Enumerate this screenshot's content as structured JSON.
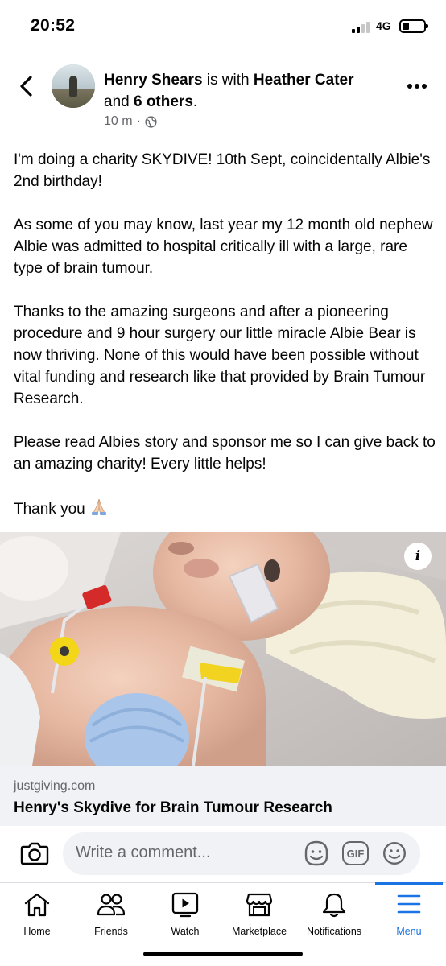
{
  "status_bar": {
    "time": "20:52",
    "network": "4G",
    "battery_level": 0.25,
    "signal_bars": 2
  },
  "post": {
    "author": "Henry Shears",
    "connector": " is with ",
    "tagged": "Heather Cater",
    "and": "and ",
    "others": "6 others",
    "period": ".",
    "time": "10 m",
    "separator": "·",
    "audience_icon": "globe-icon",
    "paragraphs": [
      "I'm doing a charity SKYDIVE! 10th Sept, coincidentally Albie's 2nd birthday!",
      "As some of you may know, last year my 12 month old nephew Albie was admitted to hospital critically ill with a large, rare type of brain tumour.",
      "Thanks to the amazing surgeons and after a pioneering procedure and 9 hour surgery our little miracle Albie Bear is now thriving. None of this would have been possible without vital funding and research like that provided by Brain Tumour Research.",
      "Please read Albies story and sponsor me so I can give back to an amazing charity! Every little helps!"
    ],
    "closing": "Thank you",
    "closing_emoji": "praying-hands-icon"
  },
  "link_preview": {
    "info_label": "i",
    "domain": "justgiving.com",
    "title": "Henry's Skydive for Brain Tumour Research"
  },
  "comment_bar": {
    "placeholder": "Write a comment...",
    "gif_label": "GIF"
  },
  "bottom_nav": {
    "items": [
      {
        "label": "Home",
        "icon": "home-icon"
      },
      {
        "label": "Friends",
        "icon": "friends-icon"
      },
      {
        "label": "Watch",
        "icon": "watch-icon"
      },
      {
        "label": "Marketplace",
        "icon": "marketplace-icon"
      },
      {
        "label": "Notifications",
        "icon": "bell-icon"
      },
      {
        "label": "Menu",
        "icon": "menu-icon"
      }
    ],
    "active": "Menu"
  },
  "colors": {
    "accent": "#1b74e4",
    "secondary_text": "#65676b",
    "input_bg": "#f0f2f5"
  }
}
